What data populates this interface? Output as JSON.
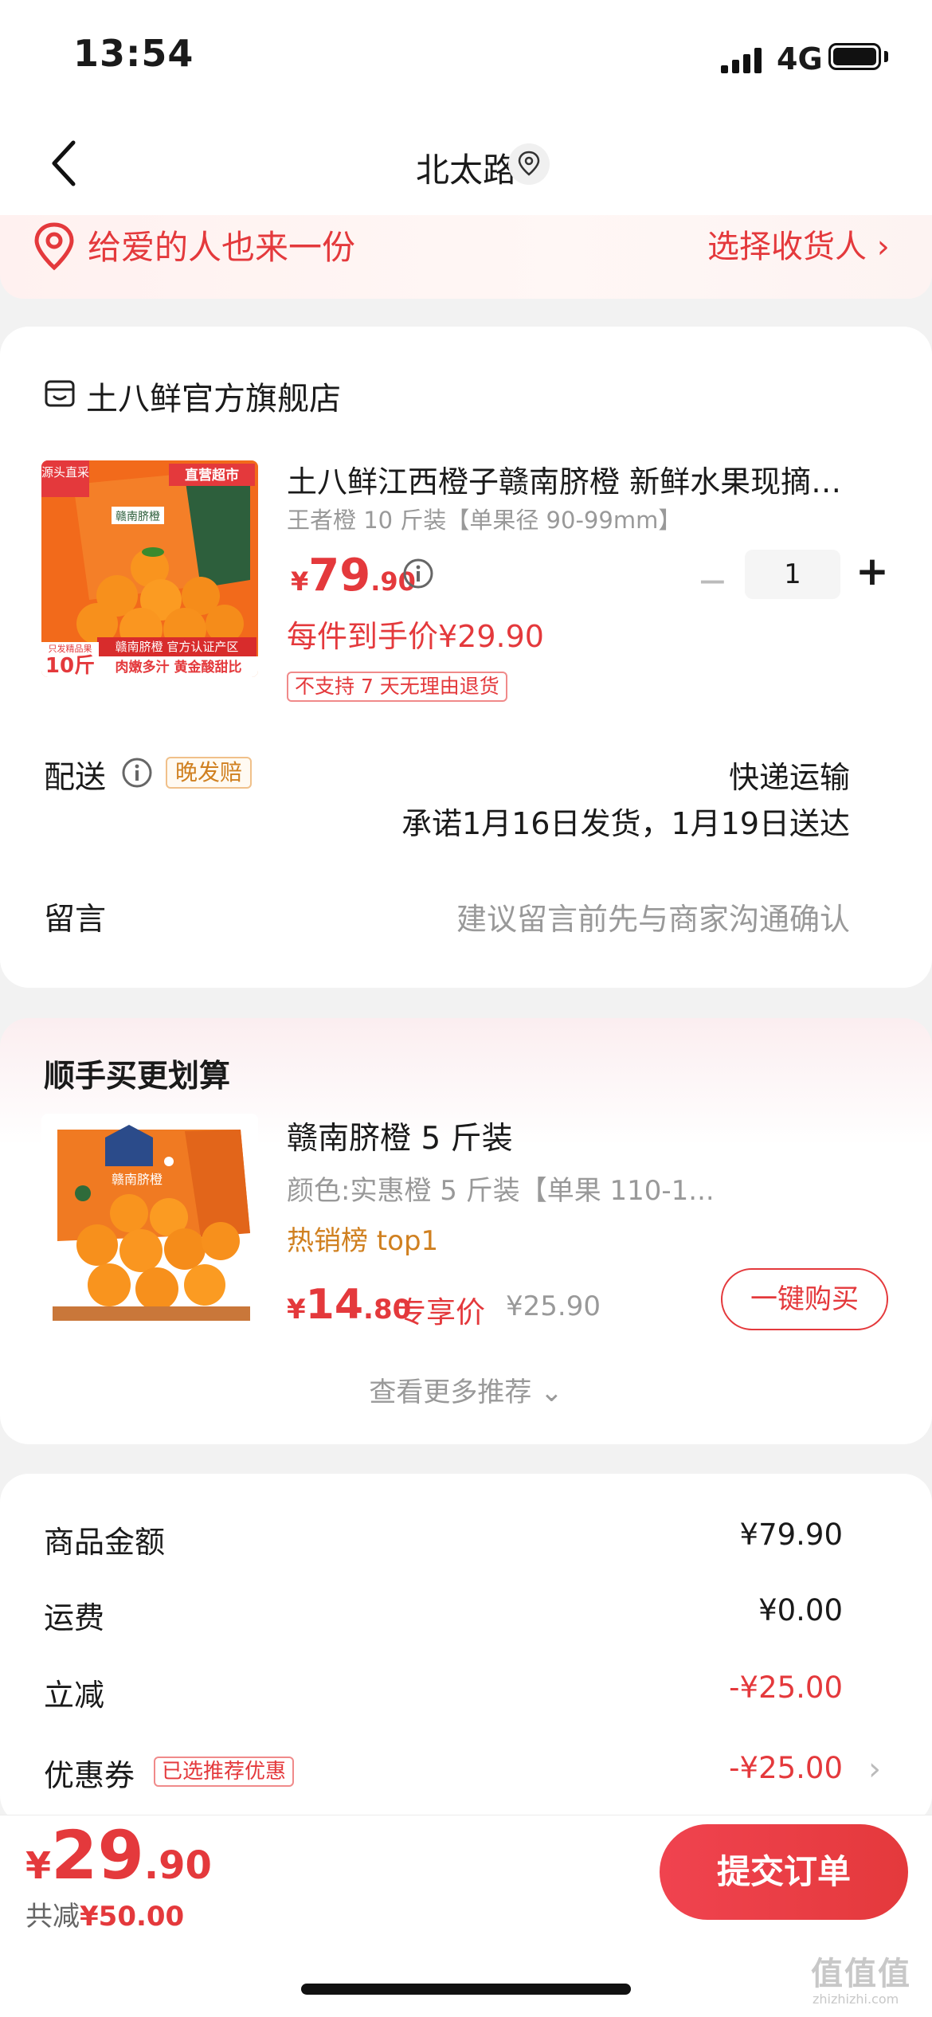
{
  "status_bar": {
    "time": "13:54",
    "network": "4G"
  },
  "nav": {
    "title": "北太路"
  },
  "banner": {
    "left_text": "给爱的人也来一份",
    "right_text": "选择收货人 ›"
  },
  "shop": {
    "name": "土八鲜官方旗舰店"
  },
  "product": {
    "title": "土八鲜江西橙子赣南脐橙 新鲜水果现摘…",
    "spec": "王者橙 10 斤装【单果径 90-99mm】",
    "price_symbol": "¥",
    "price_int": "79",
    "price_dec": ".90",
    "quantity": "1",
    "unit_price_text": "每件到手价¥29.90",
    "no_return_tag": "不支持 7 天无理由退货",
    "image_texts": {
      "top_left": "源头直采",
      "top_right": "直营超市",
      "box": "赣南脐橙",
      "weight_small": "只发精品果",
      "weight": "10斤",
      "bottom_band": "赣南脐橙 官方认证产区",
      "bottom_text": "肉嫩多汁 黄金酸甜比"
    }
  },
  "delivery": {
    "label": "配送",
    "late_badge": "晚发赔",
    "method": "快递运输",
    "promise": "承诺1月16日发货，1月19日送达"
  },
  "note": {
    "label": "留言",
    "placeholder": "建议留言前先与商家沟通确认"
  },
  "recommend": {
    "title": "顺手买更划算",
    "product_title": "赣南脐橙 5 斤装",
    "spec": "颜色:实惠橙 5 斤装【单果 110-1...",
    "rank": "热销榜 top1",
    "price_symbol": "¥",
    "price_int": "14",
    "price_dec": ".80",
    "exclusive_label": "专享价",
    "original_price": "¥25.90",
    "buy_button": "一键购买",
    "more": "查看更多推荐 ⌄",
    "image_text": "赣南脐橙"
  },
  "summary": {
    "rows": [
      {
        "label": "商品金额",
        "value": "¥79.90"
      },
      {
        "label": "运费",
        "value": "¥0.00"
      },
      {
        "label": "立减",
        "value": "-¥25.00"
      },
      {
        "label": "优惠券",
        "value": "-¥25.00"
      }
    ],
    "coupon_badge": "已选推荐优惠"
  },
  "footer": {
    "total_symbol": "¥",
    "total_int": "29",
    "total_dec": ".90",
    "saved_label": "共减",
    "saved_value": "¥50.00",
    "submit_button": "提交订单"
  },
  "watermark": {
    "main": "值值值",
    "sub": "zhizhizhi.com"
  },
  "colors": {
    "accent": "#e4393c",
    "orange": "#d08020",
    "background": "#f2f2f2"
  }
}
